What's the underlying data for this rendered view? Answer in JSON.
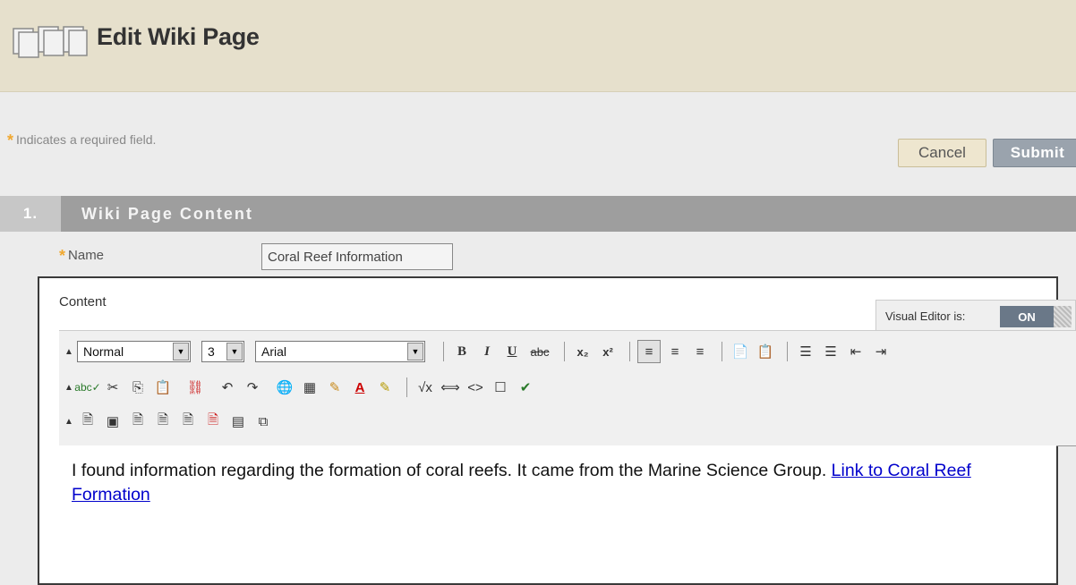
{
  "header": {
    "title": "Edit Wiki Page",
    "icon": "wiki-pages-icon"
  },
  "required_note": "Indicates a required field.",
  "buttons": {
    "cancel": "Cancel",
    "submit": "Submit"
  },
  "section": {
    "number": "1.",
    "title": "Wiki Page Content"
  },
  "fields": {
    "name_label": "Name",
    "name_value": "Coral Reef Information",
    "content_label": "Content"
  },
  "visual_editor": {
    "label": "Visual Editor is:",
    "state": "ON"
  },
  "toolbar": {
    "format": "Normal",
    "size": "3",
    "font": "Arial",
    "row1_icons": [
      "bold-icon",
      "italic-icon",
      "underline-icon",
      "strikethrough-icon",
      "subscript-icon",
      "superscript-icon",
      "align-left-icon",
      "align-center-icon",
      "align-right-icon",
      "paste-text-icon",
      "paste-word-icon",
      "ordered-list-icon",
      "unordered-list-icon",
      "outdent-icon",
      "indent-icon"
    ],
    "row2_icons": [
      "spellcheck-icon",
      "cut-icon",
      "copy-icon",
      "paste-icon",
      "remove-link-icon",
      "undo-icon",
      "redo-icon",
      "insert-link-icon",
      "table-icon",
      "edit-pencil-icon",
      "text-color-icon",
      "highlight-icon",
      "math-icon",
      "embed-icon",
      "html-icon",
      "fullscreen-icon",
      "preview-icon"
    ],
    "row3_icons": [
      "attach-file-icon",
      "insert-image-icon",
      "insert-media-icon",
      "insert-doc-icon",
      "insert-audio-icon",
      "insert-flash-icon",
      "mashup-icon",
      "wiki-link-icon"
    ]
  },
  "editor": {
    "text": "I found information regarding the formation of coral reefs. It came from the Marine Science Group. ",
    "link_text": "Link to Coral Reef Formation"
  }
}
